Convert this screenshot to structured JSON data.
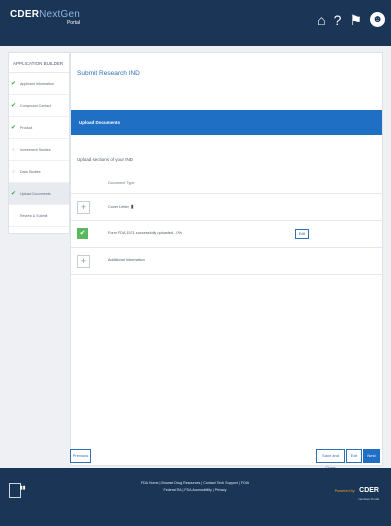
{
  "header": {
    "logo_brand": "CDER",
    "logo_accent": "NextGen",
    "logo_sub": "Portal",
    "icons": [
      "home-icon",
      "help-icon",
      "bell-icon",
      "user-icon"
    ]
  },
  "sidebar": {
    "title": "APPLICATION BUILDER",
    "items": [
      {
        "label": "Applicant Information",
        "status": "complete"
      },
      {
        "label": "Compound Contact",
        "status": "complete"
      },
      {
        "label": "Product",
        "status": "complete"
      },
      {
        "label": "Investment Studies",
        "status": "incomplete"
      },
      {
        "label": "Data Studies",
        "status": "incomplete"
      },
      {
        "label": "Upload Documents",
        "status": "complete",
        "active": true
      },
      {
        "label": "Review & Submit",
        "status": "incomplete"
      }
    ]
  },
  "main": {
    "page_title": "Submit Research IND",
    "section_title": "Upload Documents",
    "instructions": "Upload sections of your IND",
    "column_header": "Document Type",
    "rows": [
      {
        "label": "Cover Letter",
        "state": "add"
      },
      {
        "label": "Form FDA 1571 successfully uploaded - 0%",
        "state": "done",
        "action": "Edit"
      },
      {
        "label": "Additional Information",
        "state": "add"
      }
    ]
  },
  "buttons": {
    "previous": "Previous",
    "save_close": "Save and Close",
    "exit": "Exit",
    "next": "Next"
  },
  "footer": {
    "links_line1": "FDA Home | Browse Drug Resources | Contact Tech Support | FOIA",
    "links_line2": "Federal RA | FDA Accessibility | Privacy",
    "powered_label": "Powered by",
    "powered_brand": "CDER",
    "powered_sub": "NextGen Portal"
  },
  "colors": {
    "header_bg": "#1b3556",
    "accent_blue": "#1f6fc5",
    "success_green": "#57b85d"
  }
}
